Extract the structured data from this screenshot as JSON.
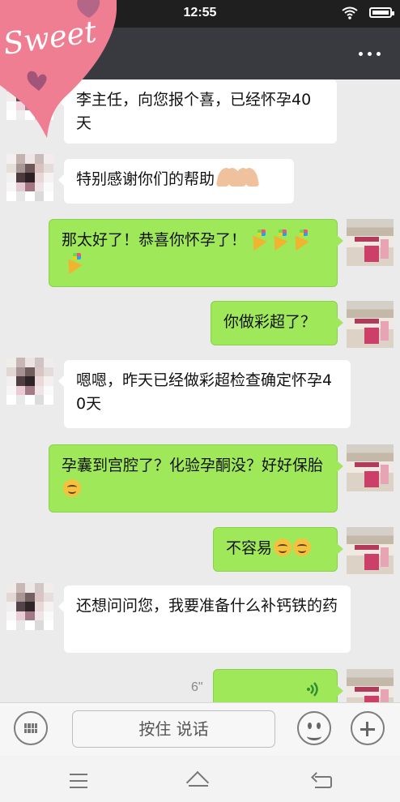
{
  "status": {
    "time": "12:55"
  },
  "messages": [
    {
      "text": "李主任，向您报个喜，已经怀孕40天"
    },
    {
      "text": "特别感谢你们的帮助"
    },
    {
      "text": "那太好了！恭喜你怀孕了！"
    },
    {
      "text": "你做彩超了？"
    },
    {
      "text": "嗯嗯，昨天已经做彩超检查确定怀孕40天"
    },
    {
      "text": "孕囊到宫腔了？化验孕酮没？好好保胎"
    },
    {
      "text": "不容易"
    },
    {
      "text": "还想问问您，我要准备什么补钙铁的药"
    }
  ],
  "voice": {
    "duration": "6\""
  },
  "input": {
    "talk_label": "按住 说话"
  },
  "sticker": {
    "text": "Sweet"
  },
  "icons": {
    "more": "more-icon",
    "keyboard": "keyboard-icon",
    "emoji": "emoji-icon",
    "plus": "plus-icon",
    "menu": "menu-icon",
    "home": "home-icon",
    "back": "back-icon",
    "voice": "voice-icon"
  },
  "colors": {
    "green_bubble": "#9fe85a",
    "white_bubble": "#ffffff",
    "chat_bg": "#ebebeb",
    "sticker_pink": "#f07e93"
  }
}
